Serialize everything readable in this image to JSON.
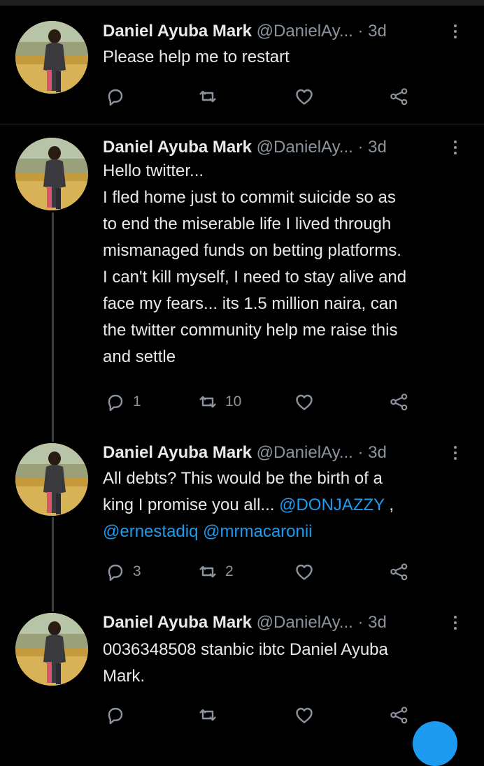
{
  "tweets": [
    {
      "name": "Daniel Ayuba Mark",
      "handle": "@DanielAy...",
      "time": "· 3d",
      "lines": [
        "Please help me to restart"
      ],
      "replies": "",
      "retweets": "",
      "likes": ""
    },
    {
      "name": "Daniel Ayuba Mark",
      "handle": "@DanielAy...",
      "time": "· 3d",
      "lines": [
        "Hello twitter...",
        "I fled home just to commit suicide so as",
        "to end the miserable life I lived through",
        "mismanaged funds on betting platforms.",
        "I can't kill myself, I need to stay alive and",
        "face my fears... its 1.5 million naira, can",
        "the twitter community help me raise this",
        "and settle"
      ],
      "replies": "1",
      "retweets": "10",
      "likes": ""
    },
    {
      "name": "Daniel Ayuba Mark",
      "handle": "@DanielAy...",
      "time": "· 3d",
      "lines": [
        "All debts? This would be the birth of a"
      ],
      "line2_prefix": "king I promise you all... ",
      "mention1": "@DONJAZZY",
      "line2_suffix": " ,",
      "mention2": "@ernestadiq",
      "mention3": "@mrmacaronii",
      "replies": "3",
      "retweets": "2",
      "likes": ""
    },
    {
      "name": "Daniel Ayuba Mark",
      "handle": "@DanielAy...",
      "time": "· 3d",
      "lines": [
        "0036348508 stanbic ibtc Daniel Ayuba",
        "Mark."
      ],
      "replies": "",
      "retweets": "",
      "likes": ""
    }
  ],
  "icons": {
    "reply": "reply-icon",
    "retweet": "retweet-icon",
    "like": "heart-icon",
    "share": "share-icon",
    "more": "more-icon"
  },
  "colors": {
    "background": "#000000",
    "text": "#e7e9ea",
    "secondary": "#8b949e",
    "accent": "#1d9bf0"
  }
}
